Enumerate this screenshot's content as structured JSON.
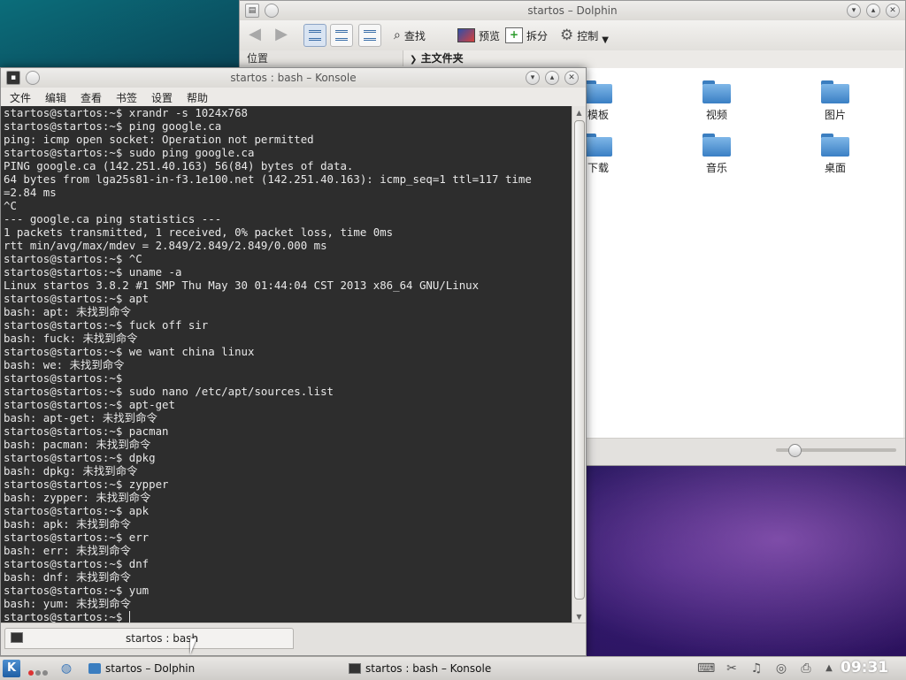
{
  "dolphin": {
    "title": "startos – Dolphin",
    "toolbar": {
      "find": "查找",
      "preview": "预览",
      "split": "拆分",
      "control": "控制"
    },
    "places_label": "位置",
    "breadcrumb": "主文件夹",
    "folders": [
      "模板",
      "视频",
      "图片",
      "下载",
      "音乐",
      "桌面"
    ]
  },
  "konsole": {
    "title": "startos : bash – Konsole",
    "menu": [
      "文件",
      "编辑",
      "查看",
      "书签",
      "设置",
      "帮助"
    ],
    "tab_label": "startos : bash",
    "lines": [
      "startos@startos:~$ xrandr -s 1024x768",
      "startos@startos:~$ ping google.ca",
      "ping: icmp open socket: Operation not permitted",
      "startos@startos:~$ sudo ping google.ca",
      "PING google.ca (142.251.40.163) 56(84) bytes of data.",
      "64 bytes from lga25s81-in-f3.1e100.net (142.251.40.163): icmp_seq=1 ttl=117 time",
      "=2.84 ms",
      "^C",
      "--- google.ca ping statistics ---",
      "1 packets transmitted, 1 received, 0% packet loss, time 0ms",
      "rtt min/avg/max/mdev = 2.849/2.849/2.849/0.000 ms",
      "startos@startos:~$ ^C",
      "startos@startos:~$ uname -a",
      "Linux startos 3.8.2 #1 SMP Thu May 30 01:44:04 CST 2013 x86_64 GNU/Linux",
      "startos@startos:~$ apt",
      "bash: apt: 未找到命令",
      "startos@startos:~$ fuck off sir",
      "bash: fuck: 未找到命令",
      "startos@startos:~$ we want china linux",
      "bash: we: 未找到命令",
      "startos@startos:~$",
      "startos@startos:~$ sudo nano /etc/apt/sources.list",
      "startos@startos:~$ apt-get",
      "bash: apt-get: 未找到命令",
      "startos@startos:~$ pacman",
      "bash: pacman: 未找到命令",
      "startos@startos:~$ dpkg",
      "bash: dpkg: 未找到命令",
      "startos@startos:~$ zypper",
      "bash: zypper: 未找到命令",
      "startos@startos:~$ apk",
      "bash: apk: 未找到命令",
      "startos@startos:~$ err",
      "bash: err: 未找到命令",
      "startos@startos:~$ dnf",
      "bash: dnf: 未找到命令",
      "startos@startos:~$ yum",
      "bash: yum: 未找到命令",
      "startos@startos:~$ "
    ]
  },
  "taskbar": {
    "task_dolphin": "startos – Dolphin",
    "task_konsole": "startos : bash – Konsole",
    "clock": "09:31"
  }
}
